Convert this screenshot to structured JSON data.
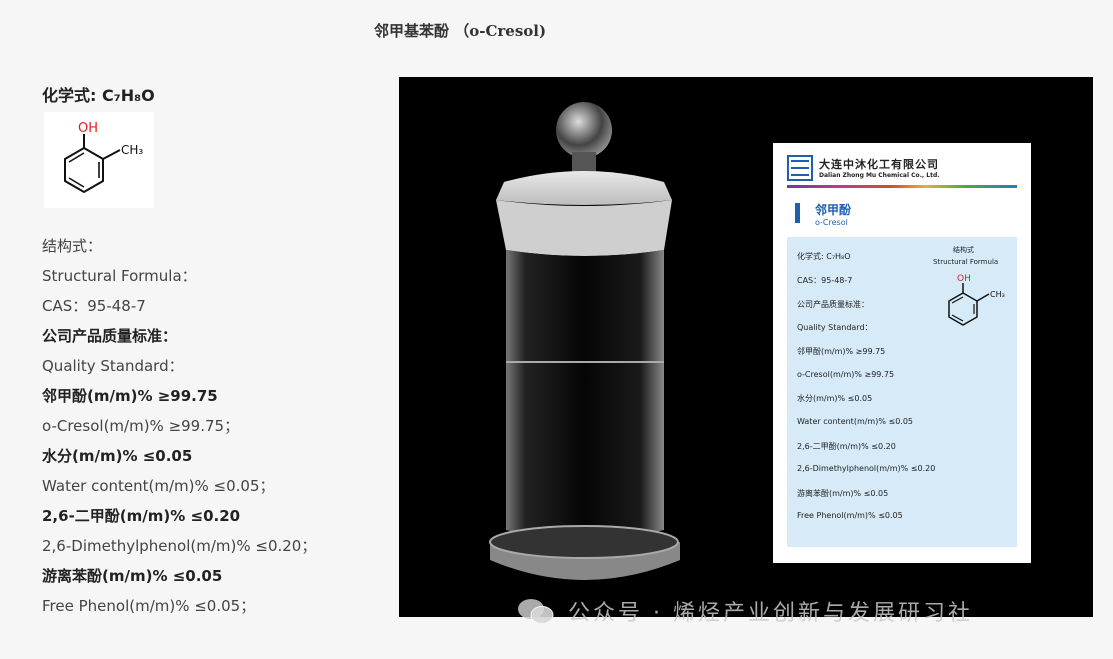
{
  "title": "邻甲基苯酚  （o-Cresol)",
  "formula_heading": "化学式: C₇H₈O",
  "structure": {
    "oh": "OH",
    "ch3": "CH₃"
  },
  "left_lines": [
    {
      "text": "结构式：",
      "bold": false
    },
    {
      "text": "Structural Formula：",
      "bold": false
    },
    {
      "text": "CAS：95-48-7",
      "bold": false
    },
    {
      "text": "公司产品质量标准：",
      "bold": true
    },
    {
      "text": "Quality Standard：",
      "bold": false
    },
    {
      "text": "邻甲酚(m/m)% ≥99.75",
      "bold": true
    },
    {
      "text": "o-Cresol(m/m)% ≥99.75；",
      "bold": false
    },
    {
      "text": "水分(m/m)% ≤0.05",
      "bold": true
    },
    {
      "text": "Water content(m/m)% ≤0.05；",
      "bold": false
    },
    {
      "text": "2,6-二甲酚(m/m)% ≤0.20",
      "bold": true
    },
    {
      "text": "2,6-Dimethylphenol(m/m)% ≤0.20；",
      "bold": false
    },
    {
      "text": "游离苯酚(m/m)% ≤0.05",
      "bold": true
    },
    {
      "text": "Free Phenol(m/m)% ≤0.05；",
      "bold": false
    }
  ],
  "label": {
    "company_cn": "大连中沐化工有限公司",
    "company_en": "Dalian Zhong Mu Chemical Co., Ltd.",
    "logo_text": "ZMCI",
    "product_cn": "邻甲酚",
    "product_en": "o-Cresol",
    "structure_cn": "结构式",
    "structure_en": "Structural Formula",
    "oh": "OH",
    "ch3": "CH₃",
    "specs": [
      "化学式: C₇H₈O",
      "CAS：95-48-7",
      "公司产品质量标准：",
      "Quality Standard：",
      "邻甲酚(m/m)% ≥99.75",
      "o-Cresol(m/m)% ≥99.75",
      "水分(m/m)% ≤0.05",
      "Water content(m/m)% ≤0.05",
      "2,6-二甲酚(m/m)% ≤0.20",
      "2,6-Dimethylphenol(m/m)% ≤0.20",
      "游离苯酚(m/m)% ≤0.05",
      "Free Phenol(m/m)% ≤0.05"
    ]
  },
  "watermark": "公众号 · 烯烃产业创新与发展研习社",
  "colors": {
    "oh_red": "#e02020",
    "label_blue": "#1f5fae",
    "panel_blue": "#d6ebf7"
  }
}
